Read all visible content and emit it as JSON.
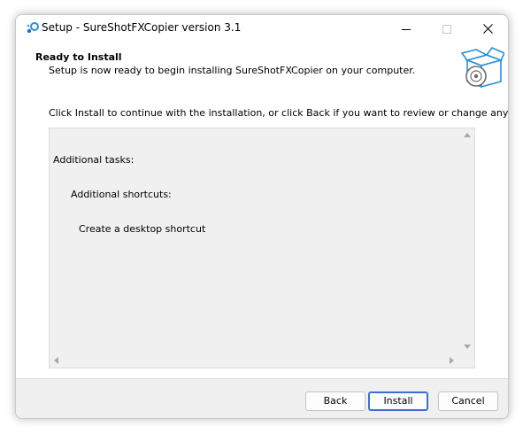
{
  "window": {
    "title": "Setup - SureShotFXCopier version 3.1",
    "controls": {
      "minimize": "minimize-icon",
      "maximize": "maximize-icon",
      "close": "close-icon"
    }
  },
  "header": {
    "title": "Ready to Install",
    "subtitle": "Setup is now ready to begin installing SureShotFXCopier on your computer."
  },
  "body": {
    "instructions": "Click Install to continue with the installation, or click Back if you want to review or change any settings.",
    "memo_lines": [
      "Additional tasks:",
      "Additional shortcuts:",
      "Create a desktop shortcut"
    ]
  },
  "buttons": {
    "back": "Back",
    "install": "Install",
    "cancel": "Cancel"
  },
  "colors": {
    "accent": "#3b6fd1",
    "footer_bg": "#f0f0f0",
    "memo_bg": "#f0f0f0",
    "icon_teal": "#2a8fd0"
  }
}
